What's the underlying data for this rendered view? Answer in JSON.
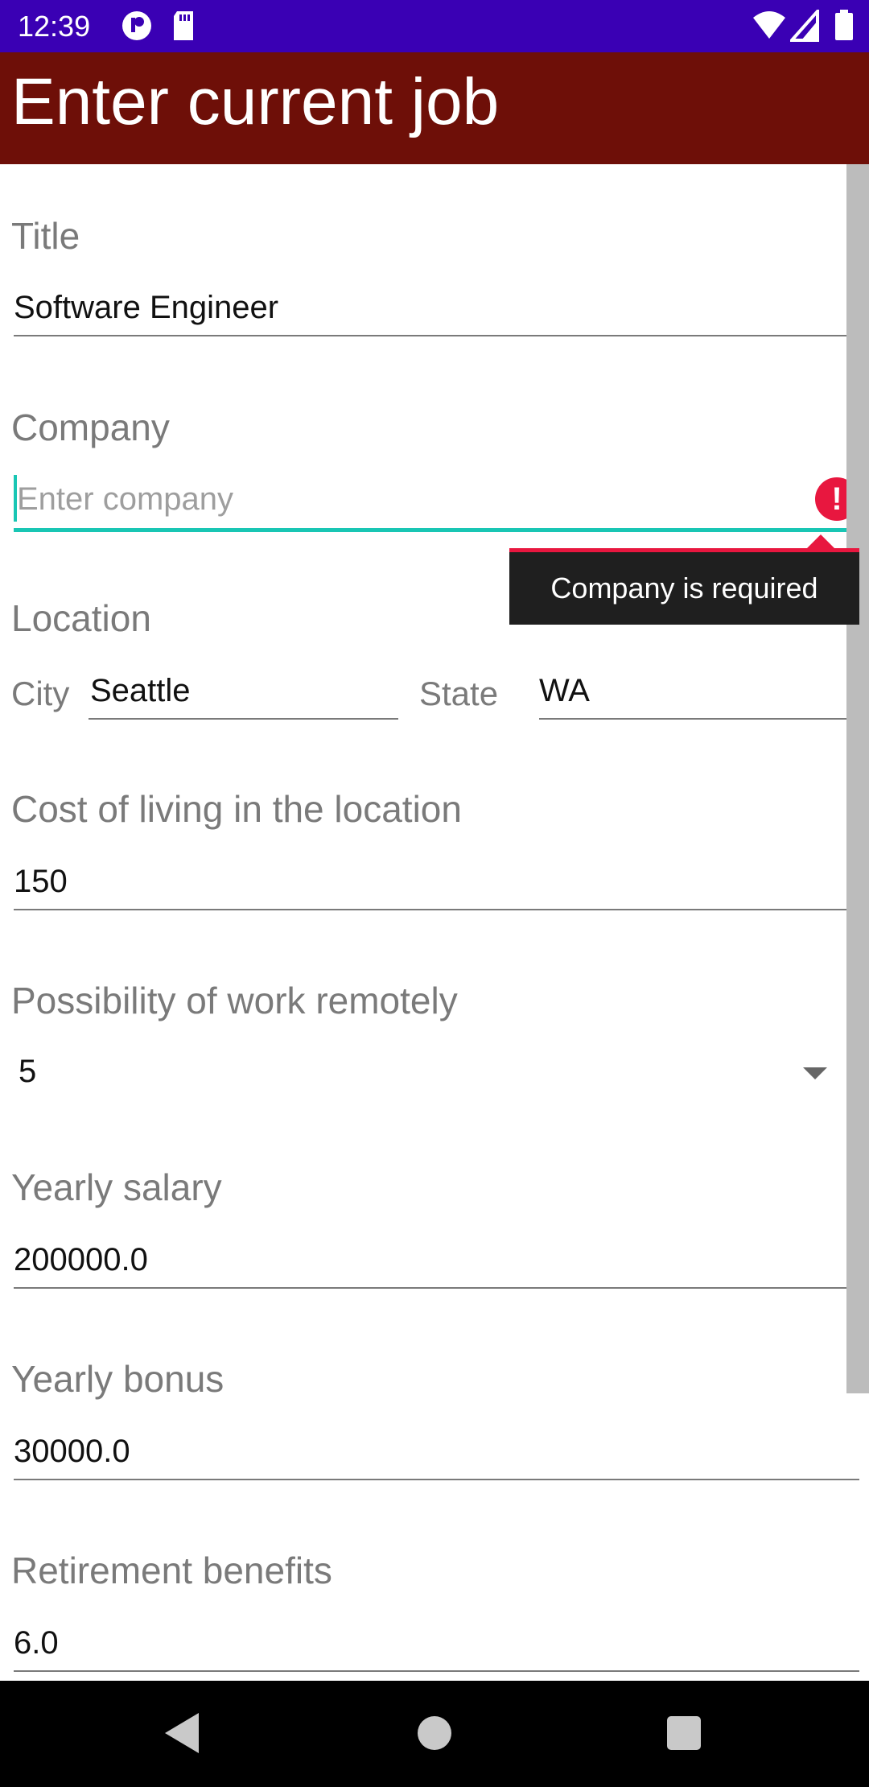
{
  "status_bar": {
    "time": "12:39",
    "left_icons": [
      "notification-p-icon",
      "sd-card-icon"
    ],
    "right_icons": [
      "wifi-icon",
      "signal-icon",
      "battery-icon"
    ]
  },
  "app_bar": {
    "title": "Enter current job"
  },
  "colors": {
    "status_bar": "#3a00b4",
    "app_bar": "#6e0f08",
    "accent": "#19c6b4",
    "error": "#e8173f",
    "tooltip_bg": "#1f1f1f"
  },
  "form": {
    "title": {
      "label": "Title",
      "value": "Software Engineer"
    },
    "company": {
      "label": "Company",
      "value": "",
      "placeholder": "Enter company",
      "error_icon": "!",
      "error": "Company is required"
    },
    "location": {
      "label": "Location",
      "city_label": "City",
      "city_value": "Seattle",
      "state_label": "State",
      "state_value": "WA"
    },
    "cost_of_living": {
      "label": "Cost of living in the location",
      "value": "150"
    },
    "remote": {
      "label": "Possibility of work remotely",
      "selected": "5"
    },
    "salary": {
      "label": "Yearly salary",
      "value": "200000.0"
    },
    "bonus": {
      "label": "Yearly bonus",
      "value": "30000.0"
    },
    "retirement": {
      "label": "Retirement benefits",
      "value": "6.0"
    }
  },
  "nav_bar": {
    "icons": [
      "back-icon",
      "home-icon",
      "recents-icon"
    ]
  }
}
